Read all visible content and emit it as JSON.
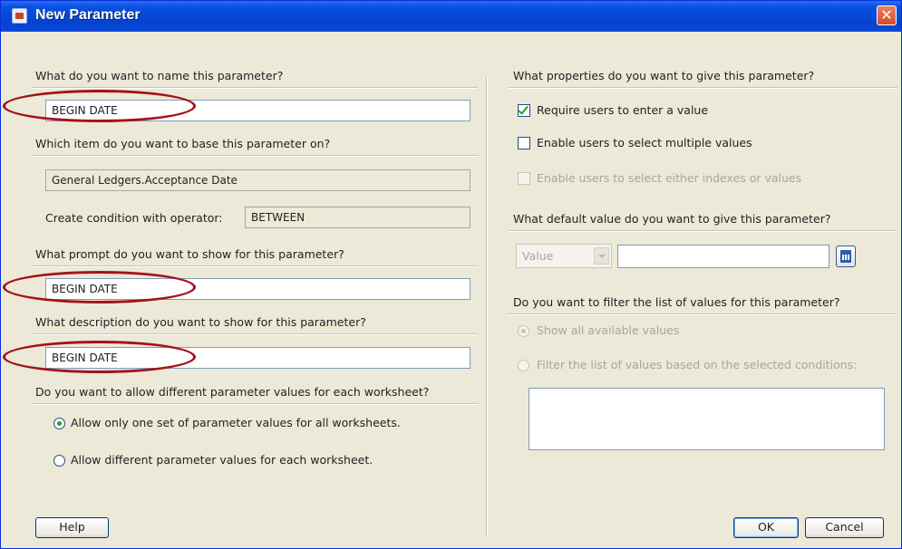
{
  "window": {
    "title": "New Parameter",
    "close_label": "✕"
  },
  "left": {
    "name_question": "What do you want to name this parameter?",
    "name_value": "BEGIN DATE",
    "base_question": "Which item do you want to base this parameter on?",
    "base_value": "General Ledgers.Acceptance Date",
    "operator_label": "Create condition with operator:",
    "operator_value": "BETWEEN",
    "prompt_question": "What prompt do you want to show for this parameter?",
    "prompt_value": "BEGIN DATE",
    "description_question": "What description do you want to show for this parameter?",
    "description_value": "BEGIN DATE",
    "worksheet_question": "Do you want to allow different parameter values for each worksheet?",
    "worksheet_options": [
      {
        "label": "Allow only one set of parameter values for all worksheets.",
        "checked": true
      },
      {
        "label": "Allow different parameter values for each worksheet.",
        "checked": false
      }
    ]
  },
  "right": {
    "properties_question": "What properties do you want to give this parameter?",
    "properties": [
      {
        "label": "Require users to enter a value",
        "checked": true,
        "enabled": true
      },
      {
        "label": "Enable users to select multiple values",
        "checked": false,
        "enabled": true
      },
      {
        "label": "Enable users to select either indexes or values",
        "checked": false,
        "enabled": false
      }
    ],
    "default_question": "What default value do you want to give this parameter?",
    "default_type": "Value",
    "default_value": "",
    "filter_question": "Do you want to filter the list of values for this parameter?",
    "filter_options": [
      {
        "label": "Show all available values",
        "checked": true,
        "enabled": false
      },
      {
        "label": "Filter the list of values based on the selected conditions:",
        "checked": false,
        "enabled": false
      }
    ]
  },
  "buttons": {
    "help": "Help",
    "ok": "OK",
    "cancel": "Cancel"
  },
  "colors": {
    "title_bar": "#0542d0",
    "dialog_bg": "#ece9d8",
    "annotation": "#a41218",
    "check": "#21a121"
  }
}
